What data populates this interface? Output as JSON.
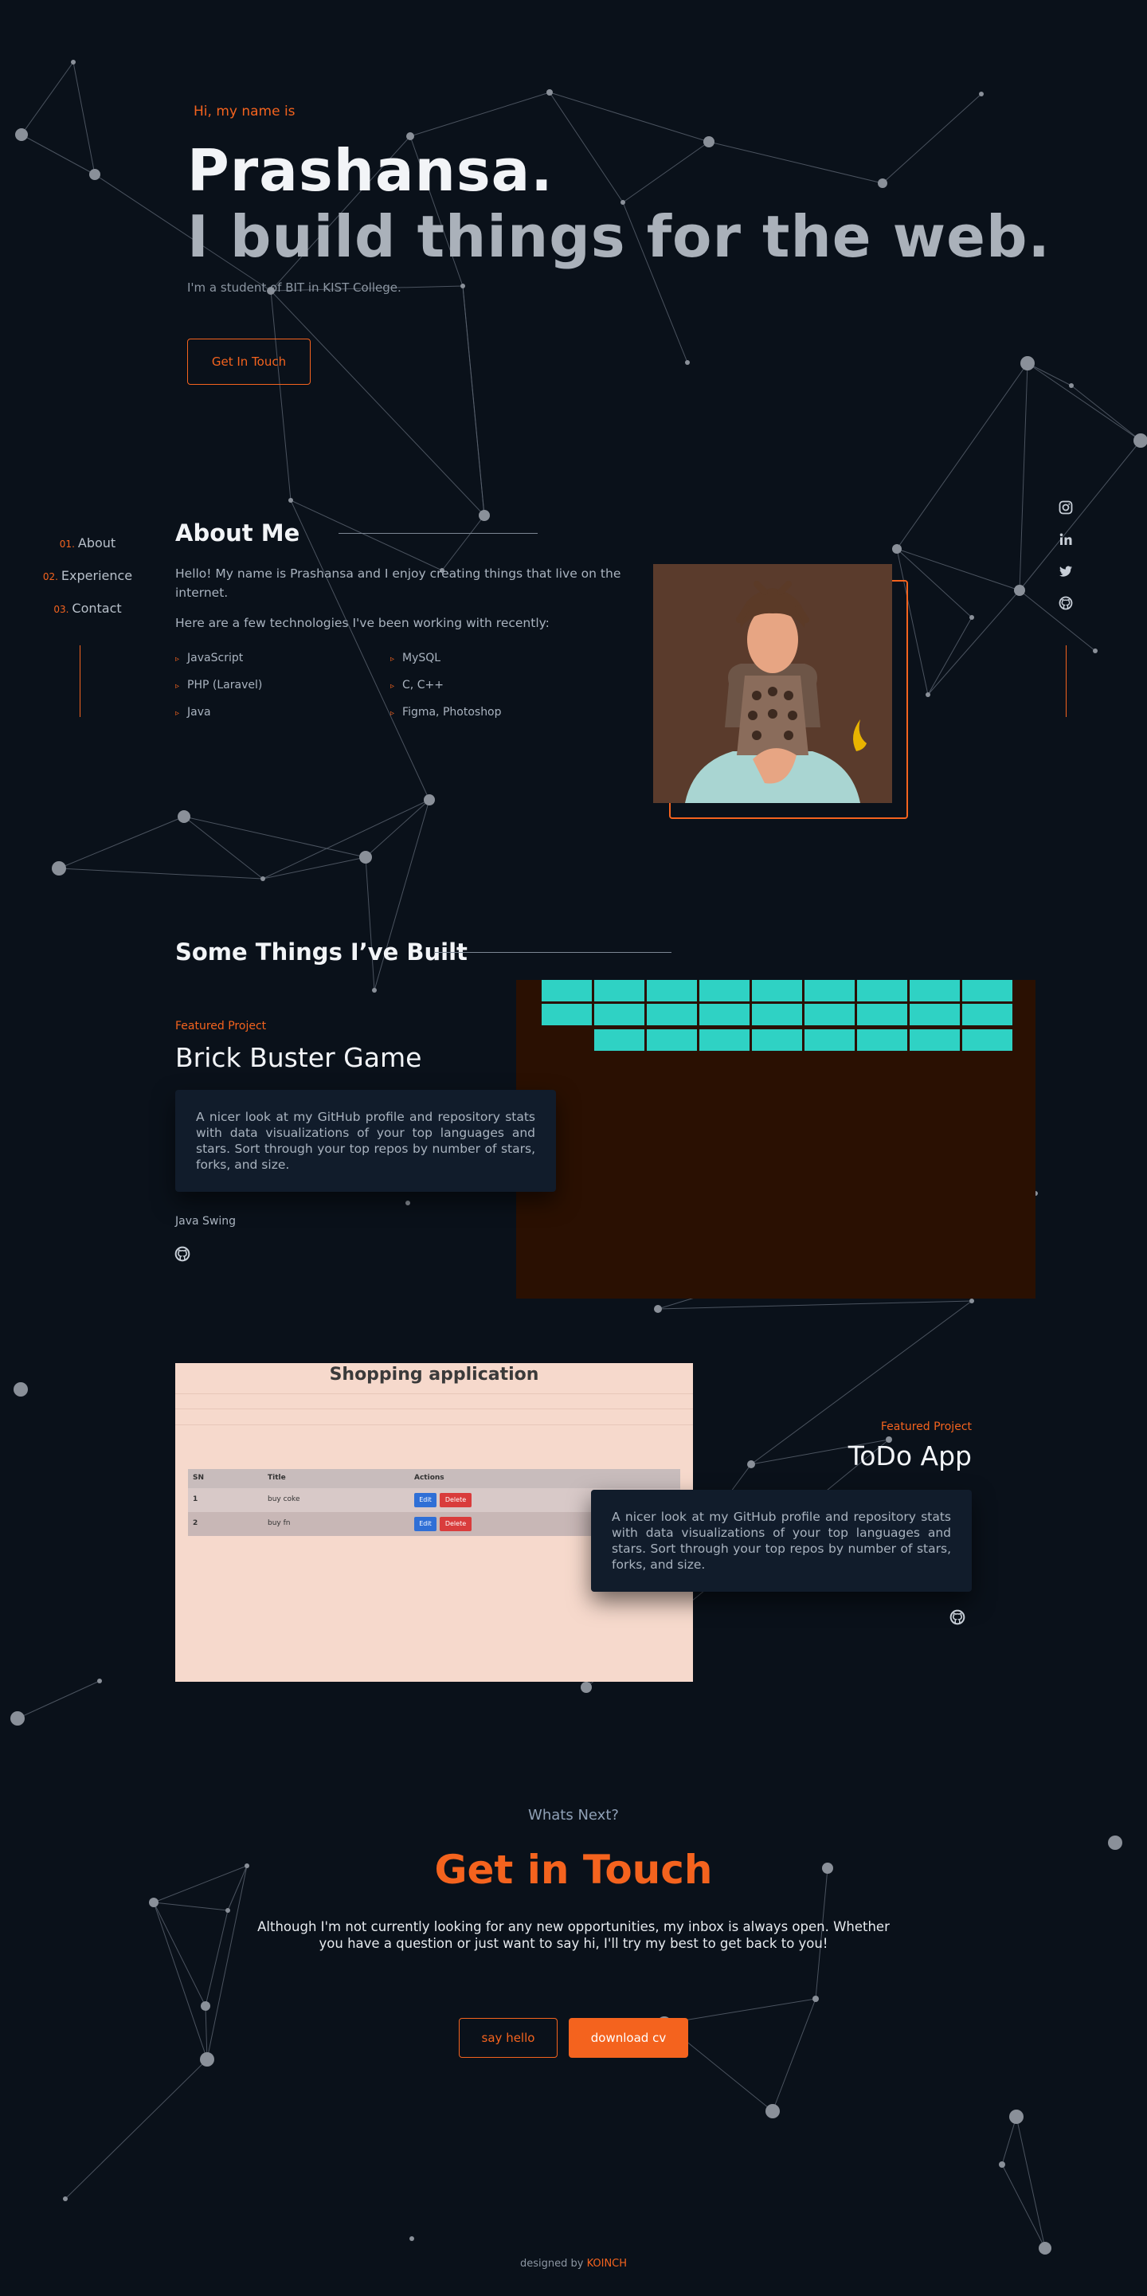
{
  "hero": {
    "greeting": "Hi, my name is",
    "name": "Prashansa.",
    "tagline": "I build things for the web.",
    "intro": "I'm a student of BIT in KIST College.",
    "cta": "Get In Touch"
  },
  "sidenav": [
    {
      "num": "01.",
      "label": "About"
    },
    {
      "num": "02.",
      "label": "Experience"
    },
    {
      "num": "03.",
      "label": "Contact"
    }
  ],
  "social": [
    "instagram-icon",
    "linkedin-icon",
    "twitter-icon",
    "github-icon"
  ],
  "about": {
    "heading": "About Me",
    "p1": "Hello! My name is Prashansa and I enjoy creating things that live on the internet.",
    "p2": "Here are a few technologies I've been working with recently:",
    "tech": [
      "JavaScript",
      "MySQL",
      "PHP (Laravel)",
      "C, C++",
      "Java",
      "Figma, Photoshop"
    ]
  },
  "projects": {
    "heading": "Some Things I’ve Built",
    "items": [
      {
        "label": "Featured Project",
        "title": "Brick Buster Game",
        "description": "A nicer look at my GitHub profile and repository stats with data visualizations of your top languages and stars. Sort through your top repos by number of stars, forks, and size.",
        "tech": "Java Swing"
      },
      {
        "label": "Featured Project",
        "title": "ToDo App",
        "description": "A nicer look at my GitHub profile and repository stats with data visualizations of your top languages and stars. Sort through your top repos by number of stars, forks, and size."
      }
    ],
    "shop": {
      "title": "Shopping application",
      "headers": [
        "SN",
        "Title",
        "Actions"
      ],
      "rows": [
        {
          "sn": "1",
          "title": "buy coke"
        },
        {
          "sn": "2",
          "title": "buy fn"
        }
      ],
      "edit": "Edit",
      "delete": "Delete"
    }
  },
  "contact": {
    "pre": "Whats Next?",
    "title": "Get in Touch",
    "text": "Although I'm not currently looking for any new opportunities, my inbox is always open. Whether you have a question or just want to say hi, I'll try my best to get back to you!",
    "hello": "say hello",
    "cv": "download cv"
  },
  "footer": {
    "prefix": "designed by",
    "brand": "KOINCH"
  },
  "colors": {
    "accent": "#f4631e",
    "background": "#0a111a",
    "brick": "#2fd2c4"
  }
}
